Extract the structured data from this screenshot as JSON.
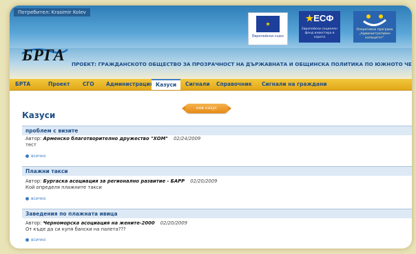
{
  "header": {
    "user_label": "Потребител: Krasimir Kolev",
    "eu_caption": "Европейски съюз",
    "esf_logo": "ЕСФ",
    "esf_caption": "Европейски социален фонд инвестира в хората",
    "op_caption": "Оперативна програма „Административен капацитет“",
    "brand": "БРГА",
    "project_title": "ПРОЕКТ: ГРАЖДАНСКОТО ОБЩЕСТВО ЗА ПРОЗРАЧНОСТ НА ДЪРЖАВНАТА И ОБЩИНСКА ПОЛИТИКА ПО ЮЖНОТО ЧЕРНОМОРИЕ"
  },
  "nav": {
    "items": [
      {
        "label": "БРТА"
      },
      {
        "label": "Проект"
      },
      {
        "label": "СГО"
      },
      {
        "label": "Администрация"
      },
      {
        "label": "Казуси"
      },
      {
        "label": "Сигнали"
      },
      {
        "label": "Справочник"
      },
      {
        "label": "Сигнали на граждани"
      }
    ],
    "active": "Казуси"
  },
  "main": {
    "title": "Казуси",
    "new_case_button": "нов казус",
    "author_prefix": "Автор:",
    "more_label": "всичко",
    "cases": [
      {
        "title": "проблем с визите",
        "author": "Арменско благотворително дружество \"ХОМ\"",
        "date": "02/24/2009",
        "text": "тест"
      },
      {
        "title": "Плажни такси",
        "author": "Бургаска асоциация за регионално развитие - БАРР",
        "date": "02/20/2009",
        "text": "Кой определя плажните такси"
      },
      {
        "title": "Заведения по плажната ивица",
        "author": "Черноморска асоциация на жените-2000",
        "date": "02/20/2009",
        "text": "От къде да си купя бански на палета???"
      }
    ]
  },
  "colors": {
    "accent": "#1e4d86",
    "nav_bg": "#e9b52a",
    "case_header_bg": "#dde9f5",
    "button": "#e58a17"
  }
}
